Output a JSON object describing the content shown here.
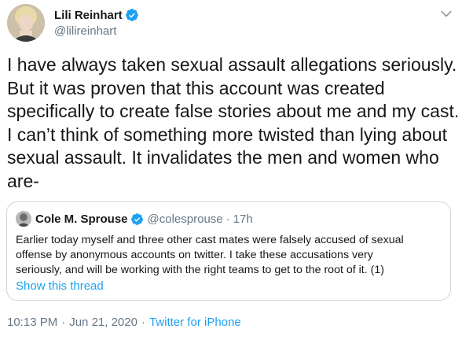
{
  "author": {
    "name": "Lili Reinhart",
    "handle": "@lilireinhart"
  },
  "tweet": {
    "lines": [
      "I have always taken sexual assault allegations seriously.",
      "But it was proven that this account was created",
      "specifically to create false stories about me and my cast.",
      "I can’t think of something more twisted than lying about",
      "sexual assault. It invalidates the men and women who",
      "are-"
    ]
  },
  "quote": {
    "name": "Cole M. Sprouse",
    "handle": "@colesprouse",
    "separator": "·",
    "time": "17h",
    "lines": [
      "Earlier today myself and three other cast mates were falsely accused of sexual",
      "offense by anonymous accounts on twitter. I take these accusations very",
      "seriously, and will be working with the right teams to get to the root of it. (1)"
    ],
    "show_thread": "Show this thread"
  },
  "meta": {
    "time": "10:13 PM",
    "dot1": "·",
    "date": "Jun 21, 2020",
    "dot2": "·",
    "source": "Twitter for iPhone"
  },
  "colors": {
    "verified": "#1da1f2",
    "link": "#1da1f2",
    "muted": "#657786",
    "border": "#ccd6dd"
  },
  "icons": {
    "verified": "verified-badge-icon",
    "more": "chevron-down-icon"
  }
}
